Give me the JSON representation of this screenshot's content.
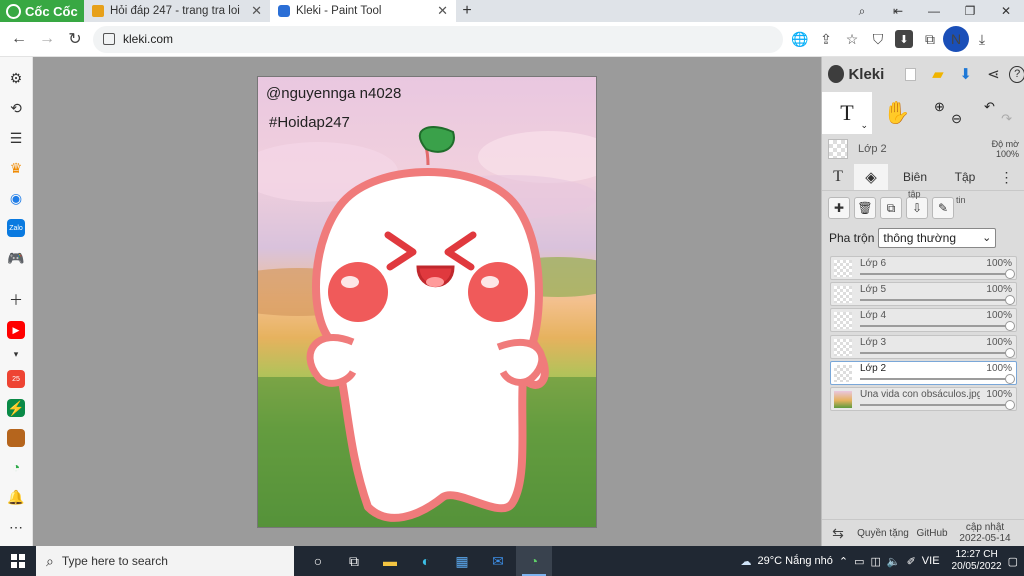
{
  "browser": {
    "brand": "Cốc Cốc",
    "tabs": [
      {
        "title": "Hỏi đáp 247 - trang tra loi",
        "active": false,
        "favicon_color": "#e7a019"
      },
      {
        "title": "Kleki - Paint Tool",
        "active": true,
        "favicon_color": "#2b6fd6"
      }
    ],
    "url": "kleki.com",
    "profile_initial": "N"
  },
  "canvas": {
    "handle_text": "@nguyennga n4028",
    "hashtag_text": "#Hoidap247"
  },
  "kleki": {
    "name": "Kleki",
    "current_layer": {
      "name": "Lớp 2",
      "opacity_label": "Độ mờ",
      "opacity": "100%"
    },
    "panel_tabs": {
      "edit": "Biên",
      "file": "Tập"
    },
    "layer_button_notes": {
      "tap": "tập",
      "tin": "tin"
    },
    "blend_label": "Pha trộn",
    "blend_value": "thông thường",
    "layers": [
      {
        "name": "Lớp 6",
        "opacity": "100%",
        "opacity_value": 1.0,
        "selected": false
      },
      {
        "name": "Lớp 5",
        "opacity": "100%",
        "opacity_value": 1.0,
        "selected": false
      },
      {
        "name": "Lớp 4",
        "opacity": "100%",
        "opacity_value": 1.0,
        "selected": false
      },
      {
        "name": "Lớp 3",
        "opacity": "100%",
        "opacity_value": 1.0,
        "selected": false
      },
      {
        "name": "Lớp 2",
        "opacity": "100%",
        "opacity_value": 1.0,
        "selected": true
      },
      {
        "name": "Una vida con obsáculos.jpg",
        "opacity": "100%",
        "opacity_value": 1.0,
        "selected": false
      }
    ],
    "footer": {
      "privacy": "Quyền tặng",
      "github": "GitHub",
      "updated_label": "cập nhật",
      "updated_date": "2022-05-14"
    }
  },
  "taskbar": {
    "search_placeholder": "Type here to search",
    "weather": "29°C Nắng nhó",
    "language": "VIE",
    "time": "12:27 CH",
    "date": "20/05/2022"
  },
  "colors": {
    "accent": "#38a843",
    "taskbar": "#202833",
    "kleki_panel": "#dcdcdc"
  }
}
